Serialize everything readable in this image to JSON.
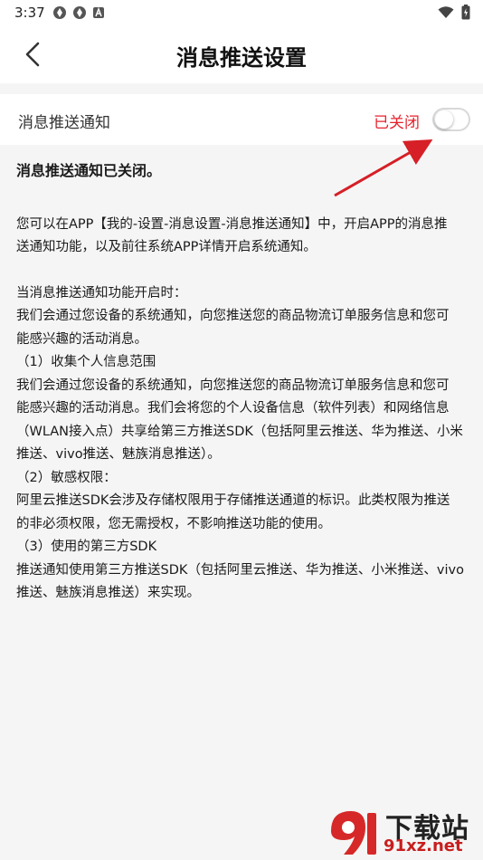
{
  "status_bar": {
    "time": "3:37",
    "app_icons": [
      "app-icon",
      "app-icon",
      "notification-a-icon"
    ],
    "right_icons": [
      "wifi-icon",
      "battery-icon"
    ]
  },
  "header": {
    "title": "消息推送设置",
    "back_icon": "chevron-left-icon"
  },
  "setting": {
    "label": "消息推送通知",
    "status": "已关闭",
    "toggle_on": false,
    "status_color": "#e5232e"
  },
  "content": {
    "headline": "消息推送通知已关闭。",
    "para1_line1": "您可以在APP【我的-设置-消息设置-消息推送通知】中，开启APP的消息推",
    "para1_line2": "送通知功能，以及前往系统APP详情开启系统通知。",
    "line3": "当消息推送通知功能开启时：",
    "line4": "我们会通过您设备的系统通知，向您推送您的商品物流订单服务信息和您可",
    "line5": "能感兴趣的活动消息。",
    "line6": "（1）收集个人信息范围",
    "line7": "我们会通过您设备的系统通知，向您推送您的商品物流订单服务信息和您可",
    "line8": "能感兴趣的活动消息。我们会将您的个人设备信息（软件列表）和网络信息",
    "line9": "（WLAN接入点）共享给第三方推送SDK（包括阿里云推送、华为推送、小米",
    "line10": "推送、vivo推送、魅族消息推送）。",
    "line11": "（2）敏感权限：",
    "line12": "阿里云推送SDK会涉及存储权限用于存储推送通道的标识。此类权限为推送",
    "line13": "的非必须权限，您无需授权，不影响推送功能的使用。",
    "line14": "（3）使用的第三方SDK",
    "line15": "推送通知使用第三方推送SDK（包括阿里云推送、华为推送、小米推送、vivo",
    "line16": "推送、魅族消息推送）来实现。"
  },
  "annotation": {
    "arrow_color": "#d61f26"
  },
  "watermark": {
    "brand": "下载站",
    "site": "91xz.net"
  }
}
